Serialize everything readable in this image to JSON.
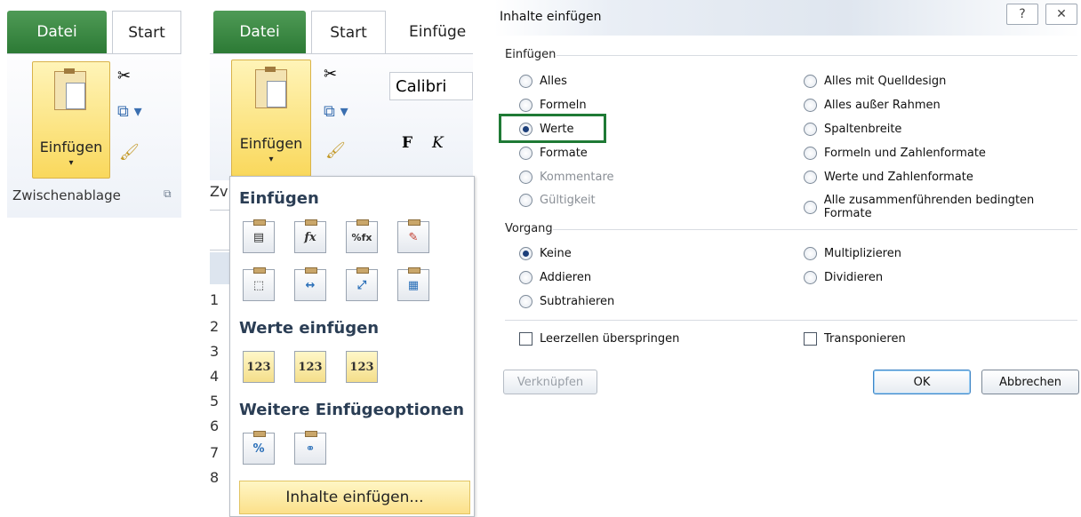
{
  "ribbon1": {
    "tab_file": "Datei",
    "tab_start": "Start",
    "paste_label": "Einfügen",
    "group_label": "Zwischenablage"
  },
  "ribbon2": {
    "tab_file": "Datei",
    "tab_start": "Start",
    "tab_insert": "Einfüge",
    "paste_label": "Einfügen",
    "font": "Calibri",
    "bold": "F",
    "italic": "K",
    "group_snip": "Zv"
  },
  "menu": {
    "section_paste": "Einfügen",
    "section_values": "Werte einfügen",
    "section_more": "Weitere Einfügeoptionen",
    "footer": "Inhalte einfügen...",
    "row_numbers": [
      "1",
      "2",
      "3",
      "4",
      "5",
      "6",
      "7",
      "8"
    ],
    "icons_paste": [
      "paste-icon",
      "formulas-icon",
      "formulas-numberformat-icon",
      "keep-source-formatting-icon",
      "no-borders-icon",
      "keep-column-width-icon",
      "transpose-icon",
      "values-formatting-icon"
    ],
    "icons_values": [
      "123",
      "123",
      "123"
    ]
  },
  "dialog": {
    "title": "Inhalte einfügen",
    "section_paste": "Einfügen",
    "paste_left": [
      "Alles",
      "Formeln",
      "Werte",
      "Formate",
      "Kommentare",
      "Gültigkeit"
    ],
    "paste_right": [
      "Alles mit Quelldesign",
      "Alles außer Rahmen",
      "Spaltenbreite",
      "Formeln und Zahlenformate",
      "Werte und Zahlenformate",
      "Alle zusammenführenden bedingten Formate"
    ],
    "selected_paste": "Werte",
    "section_operation": "Vorgang",
    "op_left": [
      "Keine",
      "Addieren",
      "Subtrahieren"
    ],
    "op_right": [
      "Multiplizieren",
      "Dividieren"
    ],
    "selected_op": "Keine",
    "skip_blanks": "Leerzellen überspringen",
    "transpose": "Transponieren",
    "link_button": "Verknüpfen",
    "ok_button": "OK",
    "cancel_button": "Abbrechen"
  }
}
